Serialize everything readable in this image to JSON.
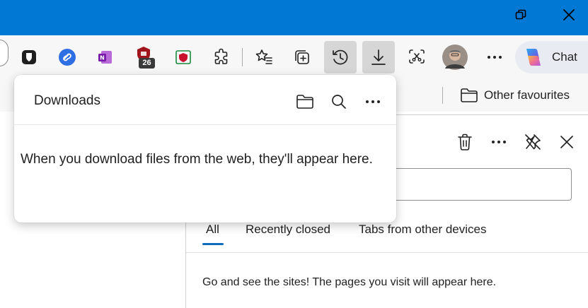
{
  "titlebar": {
    "color": "#0078d4",
    "restore_icon": "restore-icon",
    "close_icon": "close-icon"
  },
  "toolbar": {
    "extension_badge": "26",
    "chat_label": "Chat",
    "icons": [
      "bitwarden-icon",
      "link-icon",
      "onenote-icon",
      "mcafee-extension-icon",
      "mcafee-shield-icon",
      "extensions-icon",
      "favourites-icon",
      "collections-icon",
      "history-icon",
      "downloads-icon",
      "screenshot-icon",
      "profile-avatar",
      "more-icon",
      "copilot-icon"
    ]
  },
  "favourites_bar": {
    "other_favourites": "Other favourites"
  },
  "downloads": {
    "title": "Downloads",
    "empty_message": "When you download files from the web, they'll appear here."
  },
  "history": {
    "tabs": [
      "All",
      "Recently closed",
      "Tabs from other devices"
    ],
    "empty_message": "Go and see the sites! The pages you visit will appear here."
  },
  "accent_color": "#0f6cbd"
}
